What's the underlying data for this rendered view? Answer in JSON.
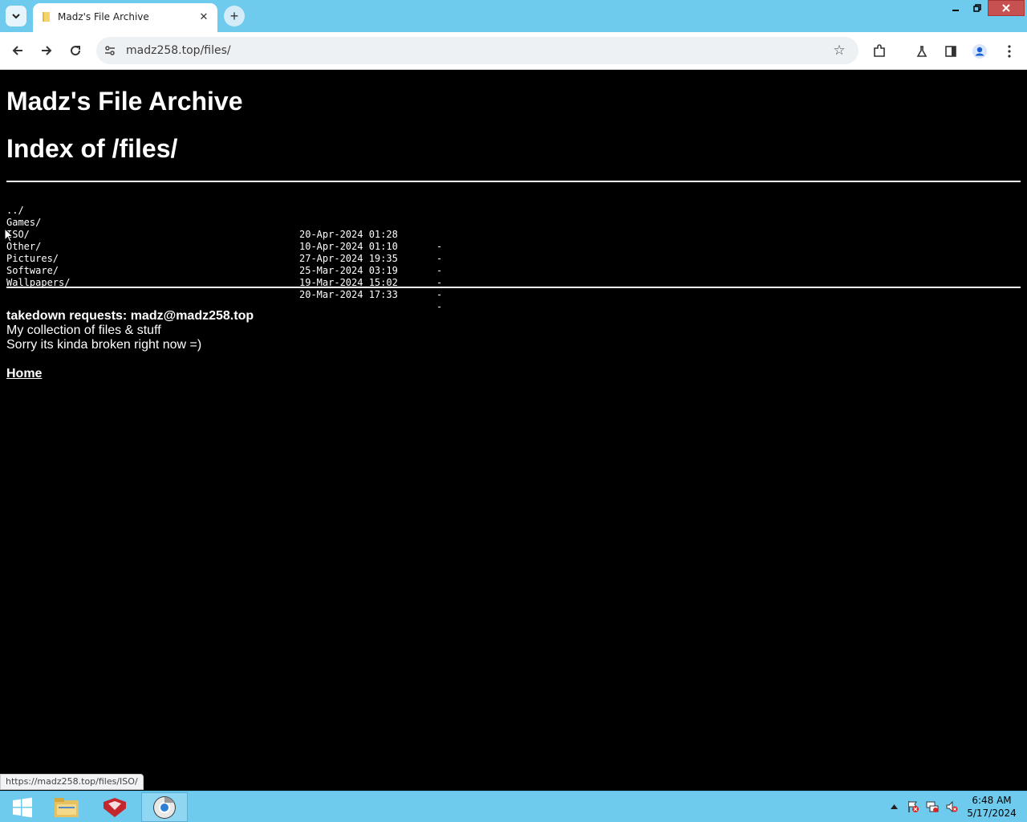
{
  "browser": {
    "tab_title": "Madz's File Archive",
    "url": "madz258.top/files/",
    "status_url": "https://madz258.top/files/ISO/"
  },
  "page": {
    "site_title": "Madz's File Archive",
    "index_title": "Index of /files/",
    "parent_link": "../",
    "entries": [
      {
        "name": "Games/",
        "date": "20-Apr-2024 01:28",
        "size": "-"
      },
      {
        "name": "ISO/",
        "date": "10-Apr-2024 01:10",
        "size": "-"
      },
      {
        "name": "Other/",
        "date": "27-Apr-2024 19:35",
        "size": "-"
      },
      {
        "name": "Pictures/",
        "date": "25-Mar-2024 03:19",
        "size": "-"
      },
      {
        "name": "Software/",
        "date": "19-Mar-2024 15:02",
        "size": "-"
      },
      {
        "name": "Wallpapers/",
        "date": "20-Mar-2024 17:33",
        "size": "-"
      }
    ],
    "footer": {
      "takedown": "takedown requests: madz@madz258.top",
      "line1": "My collection of files & stuff",
      "line2": "Sorry its kinda broken right now =)"
    },
    "home_link": "Home"
  },
  "taskbar": {
    "time": "6:48 AM",
    "date": "5/17/2024"
  }
}
